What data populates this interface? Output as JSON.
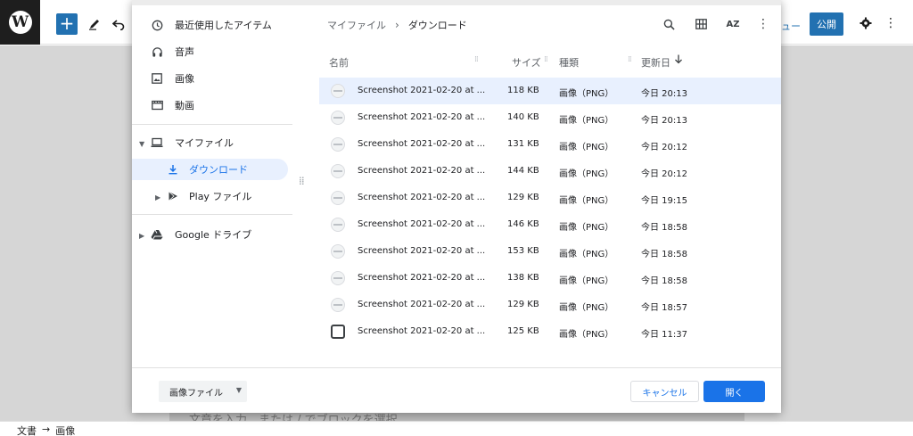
{
  "wp": {
    "preview_label": "ュー",
    "publish_label": "公開",
    "placeholder": "文章を入力、または / でブロックを選択",
    "breadcrumb": [
      "文書",
      "→",
      "画像"
    ]
  },
  "sidebar": {
    "items": [
      {
        "label": "最近使用したアイテム",
        "icon": "clock-icon"
      },
      {
        "label": "音声",
        "icon": "headphones-icon"
      },
      {
        "label": "画像",
        "icon": "image-icon"
      },
      {
        "label": "動画",
        "icon": "video-icon"
      },
      {
        "label": "マイファイル",
        "icon": "laptop-icon"
      },
      {
        "label": "ダウンロード",
        "icon": "download-icon"
      },
      {
        "label": "Play ファイル",
        "icon": "play-store-icon"
      },
      {
        "label": "Google ドライブ",
        "icon": "drive-icon"
      }
    ]
  },
  "toolbar": {
    "breadcrumb_root": "マイファイル",
    "breadcrumb_sep": "›",
    "breadcrumb_current": "ダウンロード",
    "sort_label": "AZ"
  },
  "columns": {
    "name": "名前",
    "size": "サイズ",
    "type": "種類",
    "date": "更新日"
  },
  "files": [
    {
      "name": "Screenshot 2021-02-20 at ...",
      "size": "118 KB",
      "type": "画像（PNG）",
      "date": "今日 20:13"
    },
    {
      "name": "Screenshot 2021-02-20 at ...",
      "size": "140 KB",
      "type": "画像（PNG）",
      "date": "今日 20:13"
    },
    {
      "name": "Screenshot 2021-02-20 at ...",
      "size": "131 KB",
      "type": "画像（PNG）",
      "date": "今日 20:12"
    },
    {
      "name": "Screenshot 2021-02-20 at ...",
      "size": "144 KB",
      "type": "画像（PNG）",
      "date": "今日 20:12"
    },
    {
      "name": "Screenshot 2021-02-20 at ...",
      "size": "129 KB",
      "type": "画像（PNG）",
      "date": "今日 19:15"
    },
    {
      "name": "Screenshot 2021-02-20 at ...",
      "size": "146 KB",
      "type": "画像（PNG）",
      "date": "今日 18:58"
    },
    {
      "name": "Screenshot 2021-02-20 at ...",
      "size": "153 KB",
      "type": "画像（PNG）",
      "date": "今日 18:58"
    },
    {
      "name": "Screenshot 2021-02-20 at ...",
      "size": "138 KB",
      "type": "画像（PNG）",
      "date": "今日 18:58"
    },
    {
      "name": "Screenshot 2021-02-20 at ...",
      "size": "129 KB",
      "type": "画像（PNG）",
      "date": "今日 18:57"
    },
    {
      "name": "Screenshot 2021-02-20 at ...",
      "size": "125 KB",
      "type": "画像（PNG）",
      "date": "今日 11:37"
    }
  ],
  "footer": {
    "filter_label": "画像ファイル",
    "cancel_label": "キャンセル",
    "open_label": "開く"
  },
  "colors": {
    "accent": "#1a73e8",
    "selected_row": "#e8f0fe",
    "wp_blue": "#2271b1"
  }
}
